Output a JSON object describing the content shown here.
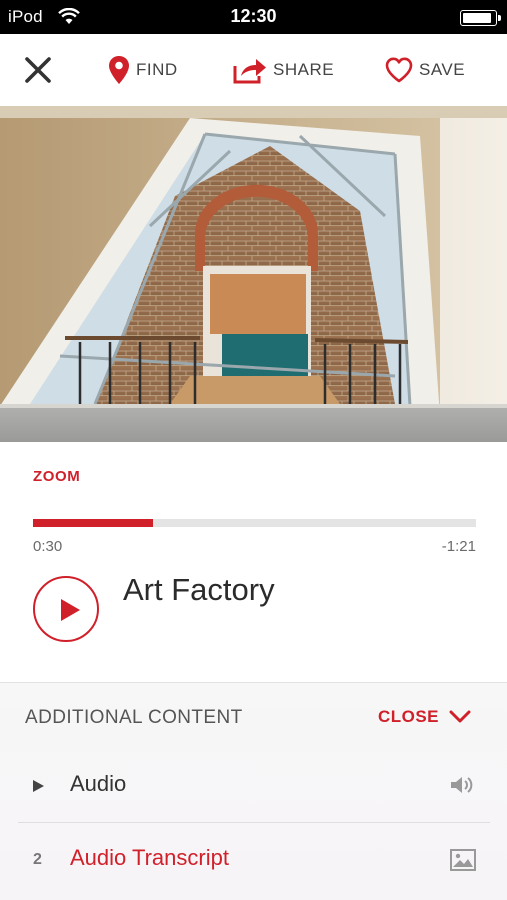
{
  "status_bar": {
    "carrier": "iPod",
    "time": "12:30",
    "battery_level": 0.9
  },
  "toolbar": {
    "close_icon": "close-icon",
    "find_label": "FIND",
    "find_icon": "location-pin-icon",
    "share_label": "SHARE",
    "share_icon": "share-arrow-icon",
    "save_label": "SAVE",
    "save_icon": "heart-icon"
  },
  "player": {
    "zoom_label": "ZOOM",
    "elapsed": "0:30",
    "remaining": "-1:21",
    "progress": 0.27,
    "title": "Art Factory",
    "play_icon": "play-icon"
  },
  "additional": {
    "heading": "ADDITIONAL CONTENT",
    "close_label": "CLOSE",
    "items": [
      {
        "marker": "▶",
        "label": "Audio",
        "icon": "speaker-icon"
      },
      {
        "marker": "2",
        "label": "Audio Transcript",
        "icon": "image-icon"
      }
    ]
  },
  "colors": {
    "accent": "#d0202a",
    "text": "#333333",
    "muted": "#6a6a6a"
  }
}
